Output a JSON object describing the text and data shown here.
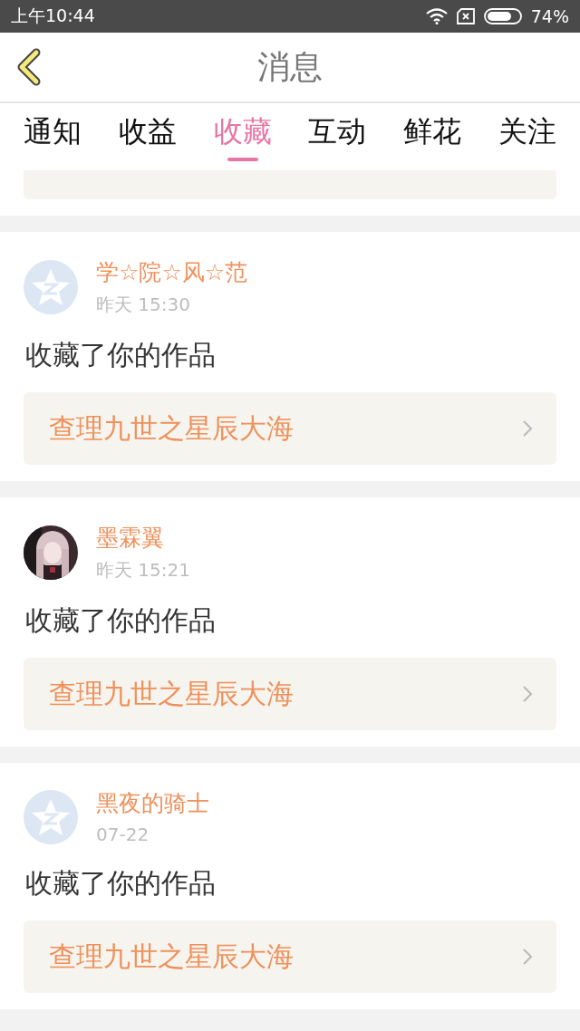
{
  "status_bar": {
    "time": "上午10:44",
    "battery": "74%"
  },
  "header": {
    "title": "消息"
  },
  "tabs": [
    {
      "label": "通知",
      "selected": false
    },
    {
      "label": "收益",
      "selected": false
    },
    {
      "label": "收藏",
      "selected": true
    },
    {
      "label": "互动",
      "selected": false
    },
    {
      "label": "鲜花",
      "selected": false
    },
    {
      "label": "关注",
      "selected": false
    }
  ],
  "messages": [
    {
      "avatar": {
        "kind": "default"
      },
      "name": "学☆院☆风☆范",
      "time": "昨天 15:30",
      "action": "收藏了你的作品",
      "work": "查理九世之星辰大海"
    },
    {
      "name": "墨霖翼",
      "time": "昨天 15:21",
      "action": "收藏了你的作品",
      "work": "查理九世之星辰大海"
    },
    {
      "avatar": {
        "kind": "default"
      },
      "name": "黑夜的骑士",
      "time": "07-22",
      "action": "收藏了你的作品",
      "work": "查理九世之星辰大海"
    }
  ]
}
